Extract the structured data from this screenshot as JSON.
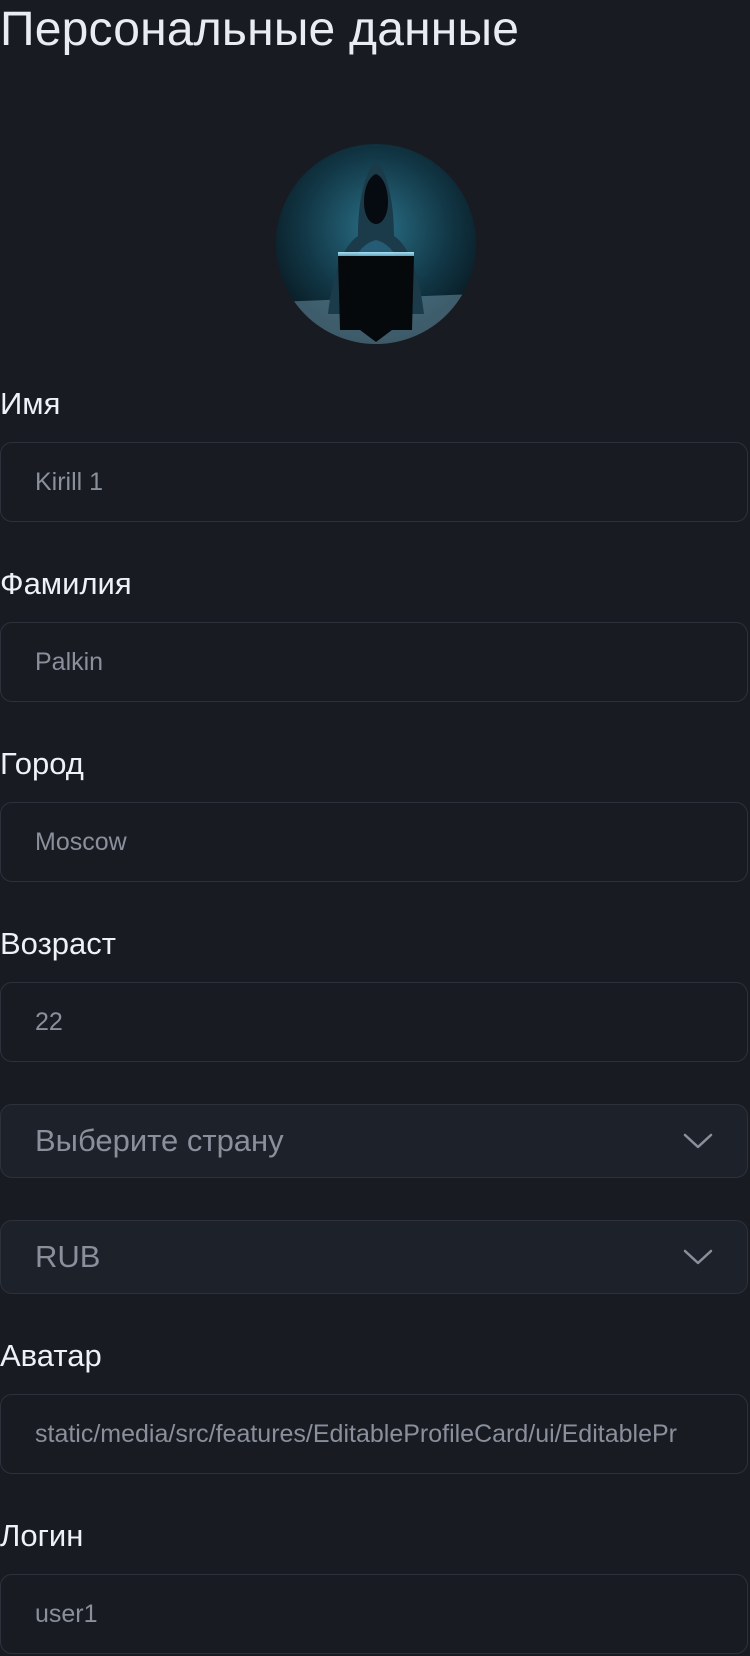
{
  "page": {
    "title": "Персональные данные"
  },
  "avatar": {
    "icon": "hooded-hacker-avatar"
  },
  "fields": {
    "first_name": {
      "label": "Имя",
      "value": "Kirill 1"
    },
    "last_name": {
      "label": "Фамилия",
      "value": "Palkin"
    },
    "city": {
      "label": "Город",
      "value": "Moscow"
    },
    "age": {
      "label": "Возраст",
      "value": "22"
    },
    "avatar_url": {
      "label": "Аватар",
      "value": "static/media/src/features/EditableProfileCard/ui/EditablePr"
    },
    "login": {
      "label": "Логин",
      "value": "user1"
    }
  },
  "selects": {
    "country": {
      "placeholder": "Выберите страну",
      "icon": "chevron-down-icon"
    },
    "currency": {
      "value": "RUB",
      "icon": "chevron-down-icon"
    }
  },
  "colors": {
    "background": "#181b22",
    "border": "#2c313b",
    "text": "#eef1f5",
    "muted_text": "#8a909b"
  }
}
